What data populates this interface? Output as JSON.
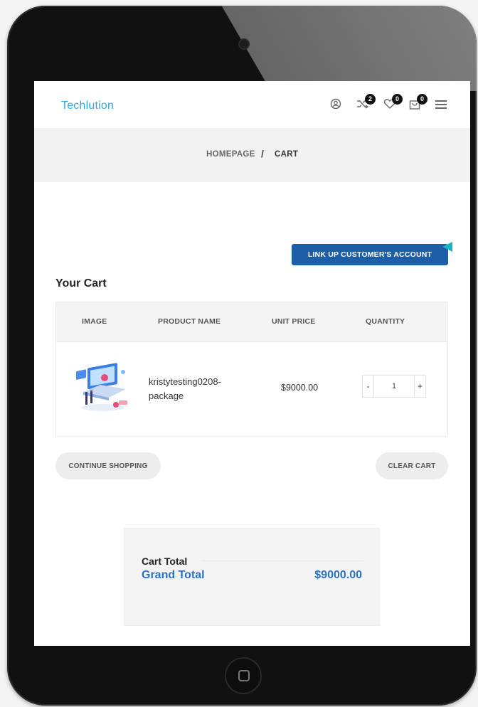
{
  "header": {
    "logo": "Techlution",
    "icons": [
      "user-icon",
      "compare-icon",
      "wishlist-icon",
      "cart-icon",
      "menu-icon"
    ],
    "compare_count": "2",
    "wishlist_count": "0",
    "cart_count": "0"
  },
  "breadcrumb": {
    "home": "HOMEPAGE",
    "separator": "/",
    "current": "CART"
  },
  "link_button": "LINK UP CUSTOMER'S ACCOUNT",
  "cart": {
    "title": "Your Cart",
    "columns": [
      "IMAGE",
      "PRODUCT NAME",
      "UNIT PRICE",
      "QUANTITY"
    ],
    "items": [
      {
        "name": "kristytesting0208-package",
        "unit_price": "$9000.00",
        "quantity": "1",
        "minus": "-",
        "plus": "+"
      }
    ],
    "continue_label": "CONTINUE SHOPPING",
    "clear_label": "CLEAR CART"
  },
  "totals": {
    "cart_total_label": "Cart Total",
    "grand_total_label": "Grand Total",
    "grand_total_value": "$9000.00"
  },
  "colors": {
    "accent": "#1c5ea8",
    "logo": "#2ea8e0",
    "grand_total": "#2a72c6",
    "pointer": "#18b4bf"
  }
}
